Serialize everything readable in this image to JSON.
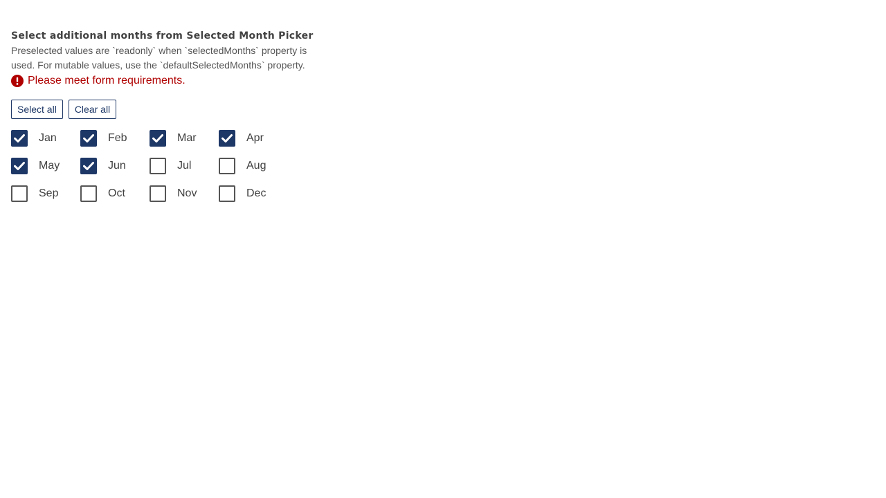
{
  "picker": {
    "title": "Select additional months from Selected Month Picker",
    "hint": "Preselected values are `readonly` when `selectedMonths` property is used. For mutable values, use the `defaultSelectedMonths` property.",
    "error": "Please meet form requirements.",
    "error_icon": "exclamation-circle-icon",
    "select_all_label": "Select all",
    "clear_all_label": "Clear all",
    "months": [
      {
        "label": "Jan",
        "checked": true
      },
      {
        "label": "Feb",
        "checked": true
      },
      {
        "label": "Mar",
        "checked": true
      },
      {
        "label": "Apr",
        "checked": true
      },
      {
        "label": "May",
        "checked": true
      },
      {
        "label": "Jun",
        "checked": true
      },
      {
        "label": "Jul",
        "checked": false
      },
      {
        "label": "Aug",
        "checked": false
      },
      {
        "label": "Sep",
        "checked": false
      },
      {
        "label": "Oct",
        "checked": false
      },
      {
        "label": "Nov",
        "checked": false
      },
      {
        "label": "Dec",
        "checked": false
      }
    ]
  },
  "colors": {
    "accent": "#1d3766",
    "error": "#b00000",
    "text": "#404040"
  }
}
